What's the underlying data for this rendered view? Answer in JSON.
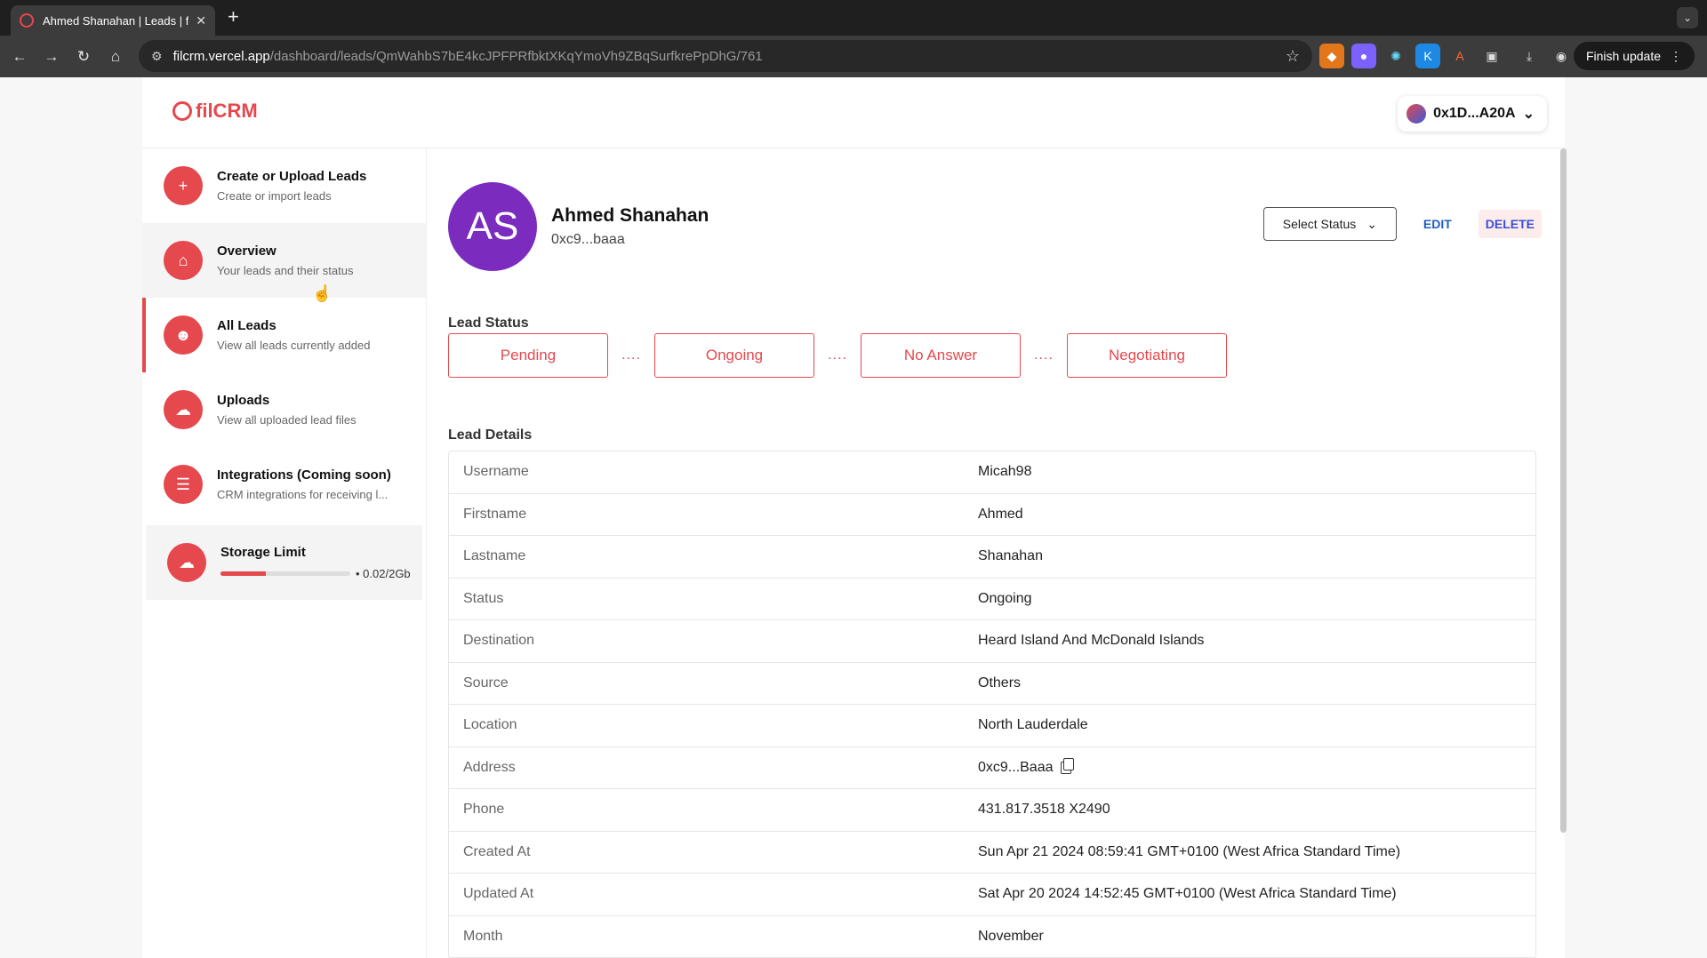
{
  "browser": {
    "tab_title": "Ahmed Shanahan | Leads | filc",
    "url_domain": "filcrm.vercel.app",
    "url_path": "/dashboard/leads/QmWahbS7bE4kcJPFPRfbktXKqYmoVh9ZBqSurfkrePpDhG/761",
    "finish_update": "Finish update"
  },
  "app": {
    "logo": "filCRM",
    "wallet": "0x1D...A20A"
  },
  "sidebar": {
    "items": [
      {
        "title": "Create or Upload Leads",
        "subtitle": "Create or import leads",
        "icon": "plus-icon"
      },
      {
        "title": "Overview",
        "subtitle": "Your leads and their status",
        "icon": "home-icon"
      },
      {
        "title": "All Leads",
        "subtitle": "View all leads currently added",
        "icon": "users-icon"
      },
      {
        "title": "Uploads",
        "subtitle": "View all uploaded lead files",
        "icon": "cloud-upload-icon"
      },
      {
        "title": "Integrations (Coming soon)",
        "subtitle": "CRM integrations for receiving l...",
        "icon": "integrations-icon"
      }
    ],
    "storage": {
      "title": "Storage Limit",
      "value": "0.02/2Gb",
      "fraction": 0.35
    }
  },
  "lead": {
    "initials": "AS",
    "name": "Ahmed Shanahan",
    "address_short": "0xc9...baaa",
    "select_status": "Select Status",
    "edit": "EDIT",
    "delete": "DELETE",
    "status_title": "Lead Status",
    "statuses": [
      "Pending",
      "Ongoing",
      "No Answer",
      "Negotiating"
    ],
    "dots": "....",
    "details_title": "Lead Details",
    "details": [
      {
        "label": "Username",
        "value": "Micah98"
      },
      {
        "label": "Firstname",
        "value": "Ahmed"
      },
      {
        "label": "Lastname",
        "value": "Shanahan"
      },
      {
        "label": "Status",
        "value": "Ongoing"
      },
      {
        "label": "Destination",
        "value": "Heard Island And McDonald Islands"
      },
      {
        "label": "Source",
        "value": "Others"
      },
      {
        "label": "Location",
        "value": "North Lauderdale"
      },
      {
        "label": "Address",
        "value": "0xc9...Baaa"
      },
      {
        "label": "Phone",
        "value": "431.817.3518 X2490"
      },
      {
        "label": "Created At",
        "value": "Sun Apr 21 2024 08:59:41 GMT+0100 (West Africa Standard Time)"
      },
      {
        "label": "Updated At",
        "value": "Sat Apr 20 2024 14:52:45 GMT+0100 (West Africa Standard Time)"
      },
      {
        "label": "Month",
        "value": "November"
      }
    ]
  },
  "colors": {
    "accent": "#e5484d",
    "avatar": "#7b2cbf"
  }
}
